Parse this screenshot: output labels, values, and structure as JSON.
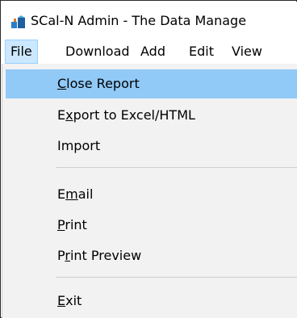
{
  "window": {
    "title": "SCal-N Admin - The Data Manage"
  },
  "menubar": {
    "items": [
      {
        "label": "File"
      },
      {
        "label": "Download"
      },
      {
        "label": "Add"
      },
      {
        "label": "Edit"
      },
      {
        "label": "View"
      }
    ]
  },
  "file_menu": {
    "items": [
      {
        "label": "Close Report",
        "mnemonic": "C",
        "highlighted": true
      },
      {
        "label": "Export to Excel/HTML",
        "mnemonic": "x"
      },
      {
        "label": "Import"
      },
      {
        "label": "Email",
        "mnemonic": "m"
      },
      {
        "label": "Print",
        "mnemonic": "P"
      },
      {
        "label": "Print Preview",
        "mnemonic": "r"
      },
      {
        "label": "Exit",
        "mnemonic": "E"
      }
    ]
  },
  "colors": {
    "highlight": "#91c9f7",
    "menu_background": "#f2f2f2",
    "open_menu_background": "#cce8ff"
  },
  "icons": {
    "app": "app-icon"
  }
}
